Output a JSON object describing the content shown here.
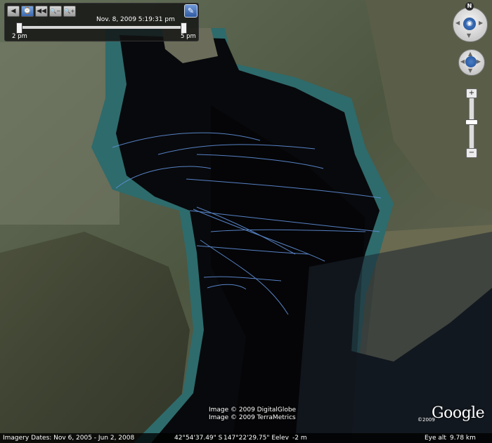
{
  "time_slider": {
    "current_time": "Nov. 8, 2009   5:19:31 pm",
    "start_label": "2 pm",
    "end_label": "5 pm",
    "buttons": [
      "◀",
      "⌚",
      "◀◀",
      "🔍−",
      "🔍+"
    ],
    "settings_icon": "wrench-icon"
  },
  "navigation": {
    "north_label": "N",
    "look_icon": "eye-icon",
    "move_icon": "hand-icon",
    "zoom_in": "+",
    "zoom_out": "−"
  },
  "attribution": {
    "line1": "Image © 2009 DigitalGlobe",
    "line2": "Image © 2009 TerraMetrics"
  },
  "logo": {
    "text": "Google",
    "copyright": "©2009"
  },
  "status_bar": {
    "imagery_dates": "Imagery Dates: Nov 6, 2005 - Jun 2, 2008",
    "latitude": "42°54'37.49\" S",
    "longitude": "147°22'29.75\" E",
    "elev_label": "elev",
    "elev_value": "-2 m",
    "eye_alt_label": "Eye alt",
    "eye_alt_value": "9.78 km"
  },
  "colors": {
    "track": "#5f8fd8",
    "deep_water": "#07090c",
    "shallow_water": "#2f6f72",
    "land": "#4f5a42"
  }
}
